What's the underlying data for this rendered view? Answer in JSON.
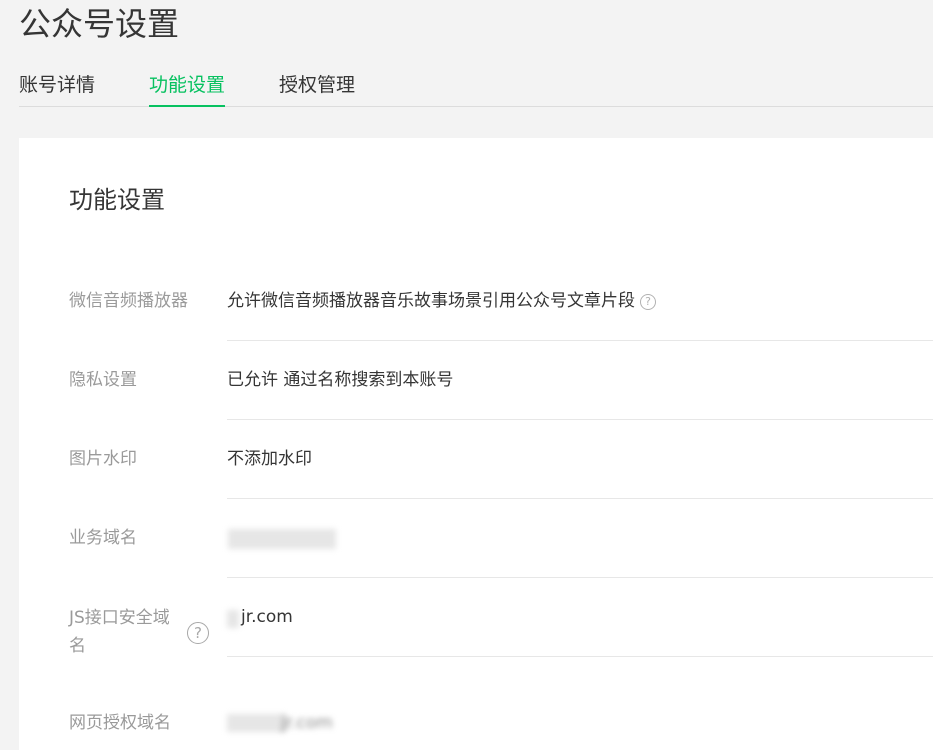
{
  "page_title": "公众号设置",
  "tabs": [
    {
      "label": "账号详情",
      "active": false
    },
    {
      "label": "功能设置",
      "active": true
    },
    {
      "label": "授权管理",
      "active": false
    }
  ],
  "card": {
    "title": "功能设置",
    "rows": [
      {
        "label": "微信音频播放器",
        "value": "允许微信音频播放器音乐故事场景引用公众号文章片段",
        "help_icon": "question-circle-icon"
      },
      {
        "label": "隐私设置",
        "value": "已允许 通过名称搜索到本账号"
      },
      {
        "label": "图片水印",
        "value": "不添加水印"
      },
      {
        "label": "业务域名",
        "value": ""
      },
      {
        "label": "JS接口安全域名",
        "value": "jr.com",
        "help_icon": "question-circle-icon"
      },
      {
        "label": "网页授权域名",
        "value": "jr.com"
      }
    ]
  },
  "colors": {
    "accent": "#07c160",
    "label_gray": "#9a9a9a",
    "text": "#353535",
    "background": "#f3f3f3",
    "card": "#ffffff"
  }
}
